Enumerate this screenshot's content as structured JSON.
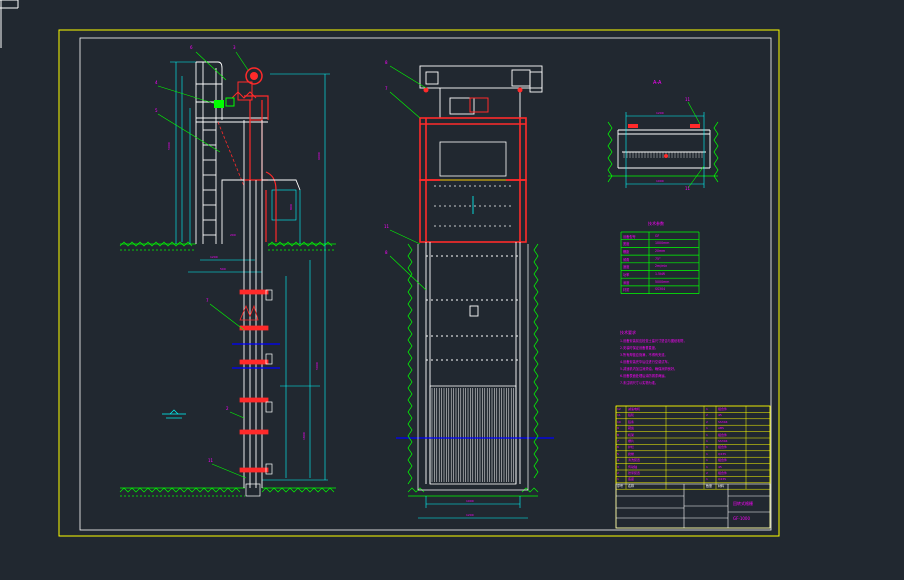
{
  "view": {
    "background": "#212830",
    "frame_color": "#ffff00",
    "line_colors": {
      "structure": "#ffffff",
      "frame_red": "#ff2a2a",
      "dimension": "#00ffff",
      "leader": "#00ff00",
      "label": "#ff00ff",
      "hatch": "#00ff00",
      "water": "#0000ff",
      "table": "#ffff00"
    }
  },
  "callouts": {
    "side_view": [
      "6",
      "3",
      "4",
      "5",
      "7",
      "2",
      "11"
    ],
    "front_view": [
      "8",
      "7",
      "11",
      "8"
    ],
    "section_view": [
      "11",
      "11"
    ]
  },
  "section_title": "A-A",
  "param_table": {
    "title": "技术参数",
    "rows": [
      [
        "设备型号",
        "GF"
      ],
      [
        "宽度",
        "1000mm"
      ],
      [
        "栅距",
        "20mm"
      ],
      [
        "倾角",
        "75°"
      ],
      [
        "速度",
        "2m/min"
      ],
      [
        "功率",
        "1.5kW"
      ],
      [
        "深度",
        "5000mm"
      ],
      [
        "材质",
        "SS304"
      ]
    ]
  },
  "notes": {
    "title": "技术要求",
    "lines": [
      "1.设备安装前应检查土建尺寸是否与图纸相符。",
      "2.安装时保证设备垂直度。",
      "3.所有焊缝应饱满，不得有夹渣。",
      "4.设备安装完毕后应进行空载试车。",
      "5.减速机内加注润滑油，确保润滑良好。",
      "6.设备表面处理后涂防锈漆两遍。",
      "7.未注明尺寸以实物为准。"
    ]
  },
  "title_block": {
    "drawing_name": "回转式格栅",
    "drawing_no": "GF-1000",
    "parts_rows": [
      [
        "12",
        "减速电机",
        "1",
        "组合件"
      ],
      [
        "11",
        "链轮",
        "2",
        "45"
      ],
      [
        "10",
        "链条",
        "2",
        "SS304"
      ],
      [
        "9",
        "耙齿",
        "1",
        "ABS"
      ],
      [
        "8",
        "机架",
        "1",
        "组合件"
      ],
      [
        "7",
        "栅片",
        "1",
        "SS304"
      ],
      [
        "6",
        "护栏",
        "1",
        "组合件"
      ],
      [
        "5",
        "爬梯",
        "1",
        "Q235"
      ],
      [
        "4",
        "清洗装置",
        "1",
        "组合件"
      ],
      [
        "3",
        "传动轴",
        "1",
        "45"
      ],
      [
        "2",
        "张紧装置",
        "2",
        "组合件"
      ],
      [
        "1",
        "底座",
        "1",
        "Q235"
      ]
    ],
    "header": [
      "序号",
      "名称",
      "数量",
      "材料"
    ]
  }
}
